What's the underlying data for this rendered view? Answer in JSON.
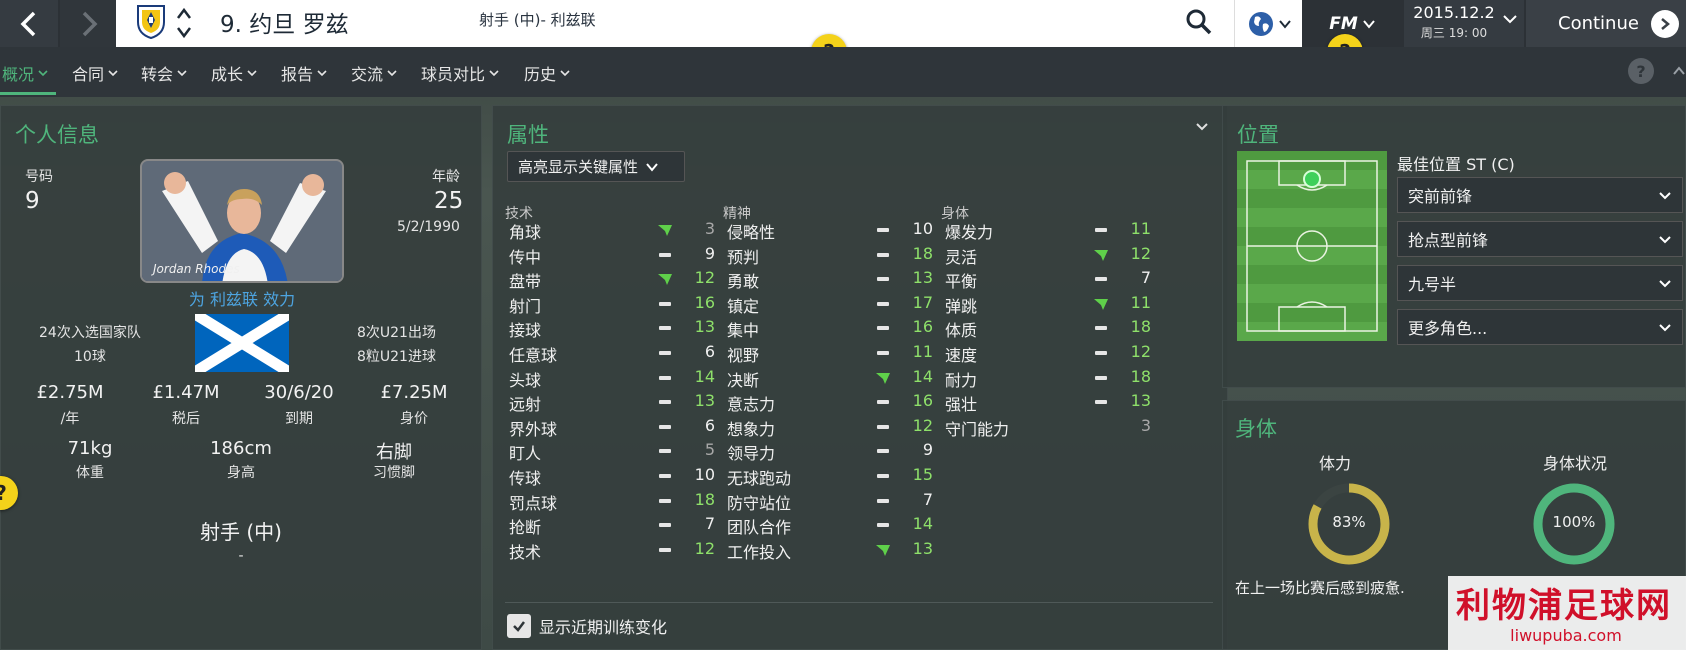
{
  "header": {
    "player_name": "9. 约旦 罗兹",
    "player_sub": "射手 (中)- 利兹联",
    "date": "2015.12.2",
    "day_time": "周三 19: 00",
    "continue_label": "Continue",
    "fm_logo": "FM",
    "help_glyph": "?"
  },
  "menu": {
    "items": [
      {
        "label": "概况",
        "active": true
      },
      {
        "label": "合同"
      },
      {
        "label": "转会"
      },
      {
        "label": "成长"
      },
      {
        "label": "报告"
      },
      {
        "label": "交流"
      },
      {
        "label": "球员对比"
      },
      {
        "label": "历史"
      }
    ]
  },
  "personal": {
    "title": "个人信息",
    "number_label": "号码",
    "number": "9",
    "age_label": "年龄",
    "age": "25",
    "dob": "5/2/1990",
    "photo_caption": "Jordan Rhodes",
    "plays_for": "为 利兹联 效力",
    "caps": "24次入选国家队",
    "goals": "10球",
    "u21_apps": "8次U21出场",
    "u21_goals": "8粒U21进球",
    "wage": "£2.75M",
    "wage_label": "/年",
    "after_tax": "£1.47M",
    "after_tax_label": "税后",
    "expires": "30/6/20",
    "expires_label": "到期",
    "value": "£7.25M",
    "value_label": "身价",
    "weight": "71kg",
    "weight_label": "体重",
    "height": "186cm",
    "height_label": "身高",
    "foot": "右脚",
    "foot_label": "习惯脚",
    "position": "射手 (中)",
    "position_sub": "-"
  },
  "attributes": {
    "title": "属性",
    "dropdown": "高亮显示关键属性",
    "checkbox_label": "显示近期训练变化",
    "columns": [
      {
        "header": "技术",
        "rows": [
          {
            "name": "角球",
            "trend": "up",
            "value": "3",
            "tone": "grey"
          },
          {
            "name": "传中",
            "trend": "flat",
            "value": "9",
            "tone": "white"
          },
          {
            "name": "盘带",
            "trend": "up",
            "value": "12",
            "tone": "green"
          },
          {
            "name": "射门",
            "trend": "flat",
            "value": "16",
            "tone": "green"
          },
          {
            "name": "接球",
            "trend": "flat",
            "value": "13",
            "tone": "green"
          },
          {
            "name": "任意球",
            "trend": "flat",
            "value": "6",
            "tone": "white"
          },
          {
            "name": "头球",
            "trend": "flat",
            "value": "14",
            "tone": "green"
          },
          {
            "name": "远射",
            "trend": "flat",
            "value": "13",
            "tone": "green"
          },
          {
            "name": "界外球",
            "trend": "flat",
            "value": "6",
            "tone": "white"
          },
          {
            "name": "盯人",
            "trend": "flat",
            "value": "5",
            "tone": "grey"
          },
          {
            "name": "传球",
            "trend": "flat",
            "value": "10",
            "tone": "white"
          },
          {
            "name": "罚点球",
            "trend": "flat",
            "value": "18",
            "tone": "green"
          },
          {
            "name": "抢断",
            "trend": "flat",
            "value": "7",
            "tone": "white"
          },
          {
            "name": "技术",
            "trend": "flat",
            "value": "12",
            "tone": "green"
          }
        ]
      },
      {
        "header": "精神",
        "rows": [
          {
            "name": "侵略性",
            "trend": "flat",
            "value": "10",
            "tone": "white"
          },
          {
            "name": "预判",
            "trend": "flat",
            "value": "18",
            "tone": "green"
          },
          {
            "name": "勇敢",
            "trend": "flat",
            "value": "13",
            "tone": "green"
          },
          {
            "name": "镇定",
            "trend": "flat",
            "value": "17",
            "tone": "green"
          },
          {
            "name": "集中",
            "trend": "flat",
            "value": "16",
            "tone": "green"
          },
          {
            "name": "视野",
            "trend": "flat",
            "value": "11",
            "tone": "green"
          },
          {
            "name": "决断",
            "trend": "up",
            "value": "14",
            "tone": "green"
          },
          {
            "name": "意志力",
            "trend": "flat",
            "value": "16",
            "tone": "green"
          },
          {
            "name": "想象力",
            "trend": "flat",
            "value": "12",
            "tone": "green"
          },
          {
            "name": "领导力",
            "trend": "flat",
            "value": "9",
            "tone": "white"
          },
          {
            "name": "无球跑动",
            "trend": "flat",
            "value": "15",
            "tone": "green"
          },
          {
            "name": "防守站位",
            "trend": "flat",
            "value": "7",
            "tone": "white"
          },
          {
            "name": "团队合作",
            "trend": "flat",
            "value": "14",
            "tone": "green"
          },
          {
            "name": "工作投入",
            "trend": "up",
            "value": "13",
            "tone": "green"
          }
        ]
      },
      {
        "header": "身体",
        "rows": [
          {
            "name": "爆发力",
            "trend": "flat",
            "value": "11",
            "tone": "green"
          },
          {
            "name": "灵活",
            "trend": "up",
            "value": "12",
            "tone": "green"
          },
          {
            "name": "平衡",
            "trend": "flat",
            "value": "7",
            "tone": "white"
          },
          {
            "name": "弹跳",
            "trend": "up",
            "value": "11",
            "tone": "green"
          },
          {
            "name": "体质",
            "trend": "flat",
            "value": "18",
            "tone": "green"
          },
          {
            "name": "速度",
            "trend": "flat",
            "value": "12",
            "tone": "green"
          },
          {
            "name": "耐力",
            "trend": "flat",
            "value": "18",
            "tone": "green"
          },
          {
            "name": "强壮",
            "trend": "flat",
            "value": "13",
            "tone": "green"
          },
          {
            "name": "守门能力",
            "trend": "none",
            "value": "3",
            "tone": "grey"
          }
        ]
      }
    ]
  },
  "position": {
    "title": "位置",
    "best": "最佳位置 ST (C)",
    "roles": [
      "突前前锋",
      "抢点型前锋",
      "九号半",
      "更多角色..."
    ]
  },
  "physical": {
    "title": "身体",
    "stamina_label": "体力",
    "stamina_text": "83%",
    "stamina_fraction": 0.83,
    "condition_label": "身体状况",
    "condition_text": "100%",
    "condition_fraction": 1.0,
    "note": "在上一场比赛后感到疲惫."
  },
  "watermark": {
    "main": "利物浦足球网",
    "sub": "liwupuba.com"
  },
  "colors": {
    "accent_green": "#4fb57c",
    "value_green": "#8ee06a",
    "stamina_yellow": "#c8b44a",
    "condition_green": "#4fb57c",
    "help_yellow": "#f4d21a"
  }
}
